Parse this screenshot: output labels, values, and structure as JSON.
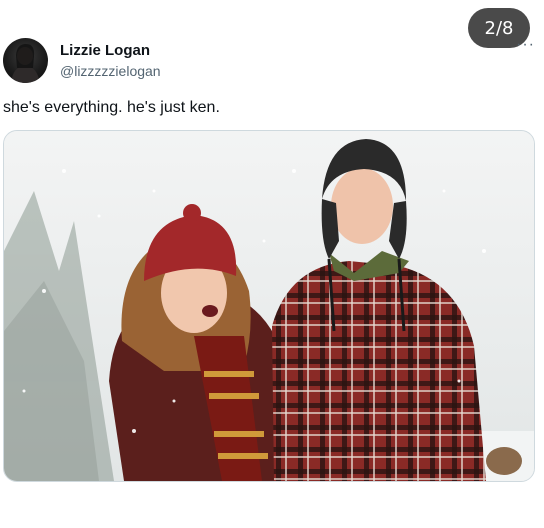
{
  "carousel": {
    "counter": "2/8"
  },
  "tweet": {
    "author_name": "Lizzie Logan",
    "author_handle": "@lizzzzzielogan",
    "text": "she's everything. he's just ken.",
    "more_icon": "more-horizontal-icon"
  },
  "media": {
    "description_icon": "photo",
    "colors": {
      "coat": "#5b1f1c",
      "scarf": "#7a1a14",
      "scarf_stripe": "#d09a3a",
      "plaid": "#8a2a26",
      "hat_red": "#a3282a",
      "hat_dark": "#2a2a2a",
      "sky": "#eef0f0"
    }
  }
}
